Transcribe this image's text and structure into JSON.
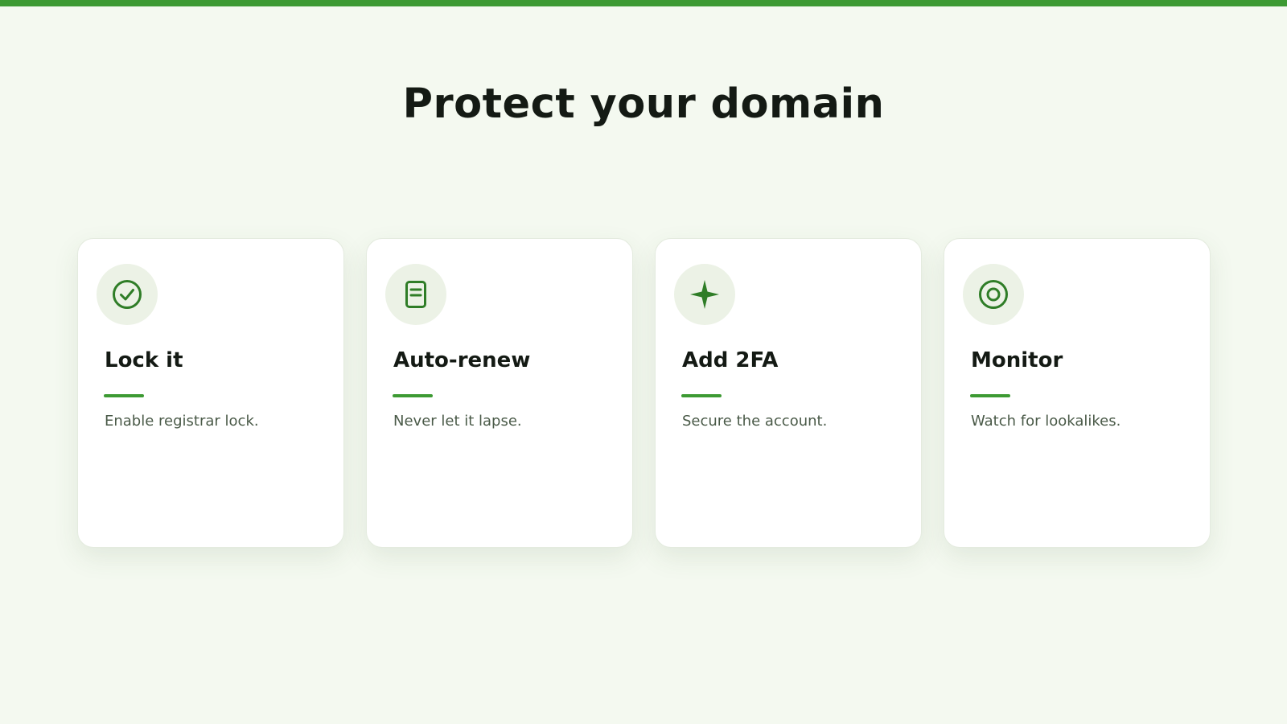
{
  "header": {
    "title": "Protect your domain"
  },
  "colors": {
    "accent": "#3d9a33",
    "icon": "#2f7d27",
    "background": "#f4f9f0",
    "icon_bg": "#ecf2e6"
  },
  "cards": [
    {
      "icon": "check-circle-icon",
      "title": "Lock it",
      "description": "Enable registrar lock."
    },
    {
      "icon": "document-icon",
      "title": "Auto-renew",
      "description": "Never let it lapse."
    },
    {
      "icon": "sparkle-icon",
      "title": "Add 2FA",
      "description": "Secure the account."
    },
    {
      "icon": "target-icon",
      "title": "Monitor",
      "description": "Watch for lookalikes."
    }
  ]
}
